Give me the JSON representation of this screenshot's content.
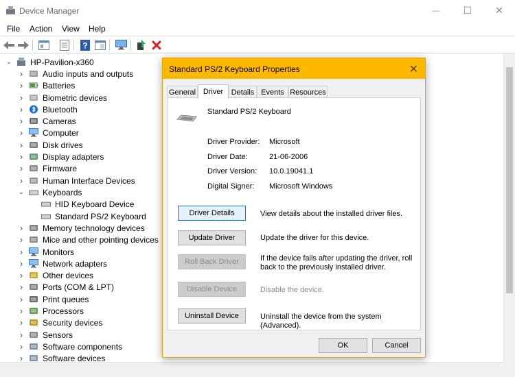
{
  "window": {
    "title": "Device Manager"
  },
  "window_controls": {
    "minimize": "—",
    "maximize": "☐",
    "close": "✕"
  },
  "menu": [
    "File",
    "Action",
    "View",
    "Help"
  ],
  "toolbar_icons": [
    "back-arrow-icon",
    "forward-arrow-icon",
    "properties-icon",
    "show-hidden-icon",
    "help-icon",
    "properties-panel-icon",
    "monitor-scan-icon",
    "update-driver-icon",
    "uninstall-icon"
  ],
  "tree": {
    "root": "HP-Pavilion-x360",
    "categories": [
      {
        "label": "Audio inputs and outputs",
        "icon": "speaker-icon",
        "expanded": false
      },
      {
        "label": "Batteries",
        "icon": "battery-icon",
        "expanded": false
      },
      {
        "label": "Biometric devices",
        "icon": "fingerprint-icon",
        "expanded": false
      },
      {
        "label": "Bluetooth",
        "icon": "bluetooth-icon",
        "expanded": false
      },
      {
        "label": "Cameras",
        "icon": "camera-icon",
        "expanded": false
      },
      {
        "label": "Computer",
        "icon": "computer-icon",
        "expanded": false
      },
      {
        "label": "Disk drives",
        "icon": "disk-drive-icon",
        "expanded": false
      },
      {
        "label": "Display adapters",
        "icon": "display-adapter-icon",
        "expanded": false
      },
      {
        "label": "Firmware",
        "icon": "firmware-icon",
        "expanded": false
      },
      {
        "label": "Human Interface Devices",
        "icon": "hid-icon",
        "expanded": false
      },
      {
        "label": "Keyboards",
        "icon": "keyboard-icon",
        "expanded": true,
        "children": [
          "HID Keyboard Device",
          "Standard PS/2 Keyboard"
        ]
      },
      {
        "label": "Memory technology devices",
        "icon": "memory-icon",
        "expanded": false
      },
      {
        "label": "Mice and other pointing devices",
        "icon": "mouse-icon",
        "expanded": false
      },
      {
        "label": "Monitors",
        "icon": "monitor-icon",
        "expanded": false
      },
      {
        "label": "Network adapters",
        "icon": "network-icon",
        "expanded": false
      },
      {
        "label": "Other devices",
        "icon": "other-devices-icon",
        "expanded": false
      },
      {
        "label": "Ports (COM & LPT)",
        "icon": "port-icon",
        "expanded": false
      },
      {
        "label": "Print queues",
        "icon": "printer-icon",
        "expanded": false
      },
      {
        "label": "Processors",
        "icon": "processor-icon",
        "expanded": false
      },
      {
        "label": "Security devices",
        "icon": "security-icon",
        "expanded": false
      },
      {
        "label": "Sensors",
        "icon": "sensor-icon",
        "expanded": false
      },
      {
        "label": "Software components",
        "icon": "software-component-icon",
        "expanded": false
      },
      {
        "label": "Software devices",
        "icon": "software-device-icon",
        "expanded": false
      }
    ]
  },
  "dialog": {
    "title": "Standard PS/2 Keyboard Properties",
    "title_color": "#fcb900",
    "tabs": [
      "General",
      "Driver",
      "Details",
      "Events",
      "Resources"
    ],
    "active_tab": "Driver",
    "device_name": "Standard PS/2 Keyboard",
    "properties": [
      {
        "label": "Driver Provider:",
        "value": "Microsoft"
      },
      {
        "label": "Driver Date:",
        "value": "21-06-2006"
      },
      {
        "label": "Driver Version:",
        "value": "10.0.19041.1"
      },
      {
        "label": "Digital Signer:",
        "value": "Microsoft Windows"
      }
    ],
    "actions": [
      {
        "label": "Driver Details",
        "desc": "View details about the installed driver files.",
        "enabled": true,
        "focused": true
      },
      {
        "label": "Update Driver",
        "desc": "Update the driver for this device.",
        "enabled": true,
        "focused": false
      },
      {
        "label": "Roll Back Driver",
        "desc": "If the device fails after updating the driver, roll back to the previously installed driver.",
        "enabled": false,
        "focused": false
      },
      {
        "label": "Disable Device",
        "desc": "Disable the device.",
        "enabled": false,
        "focused": false
      },
      {
        "label": "Uninstall Device",
        "desc": "Uninstall the device from the system (Advanced).",
        "enabled": true,
        "focused": false
      }
    ],
    "ok_label": "OK",
    "cancel_label": "Cancel"
  }
}
